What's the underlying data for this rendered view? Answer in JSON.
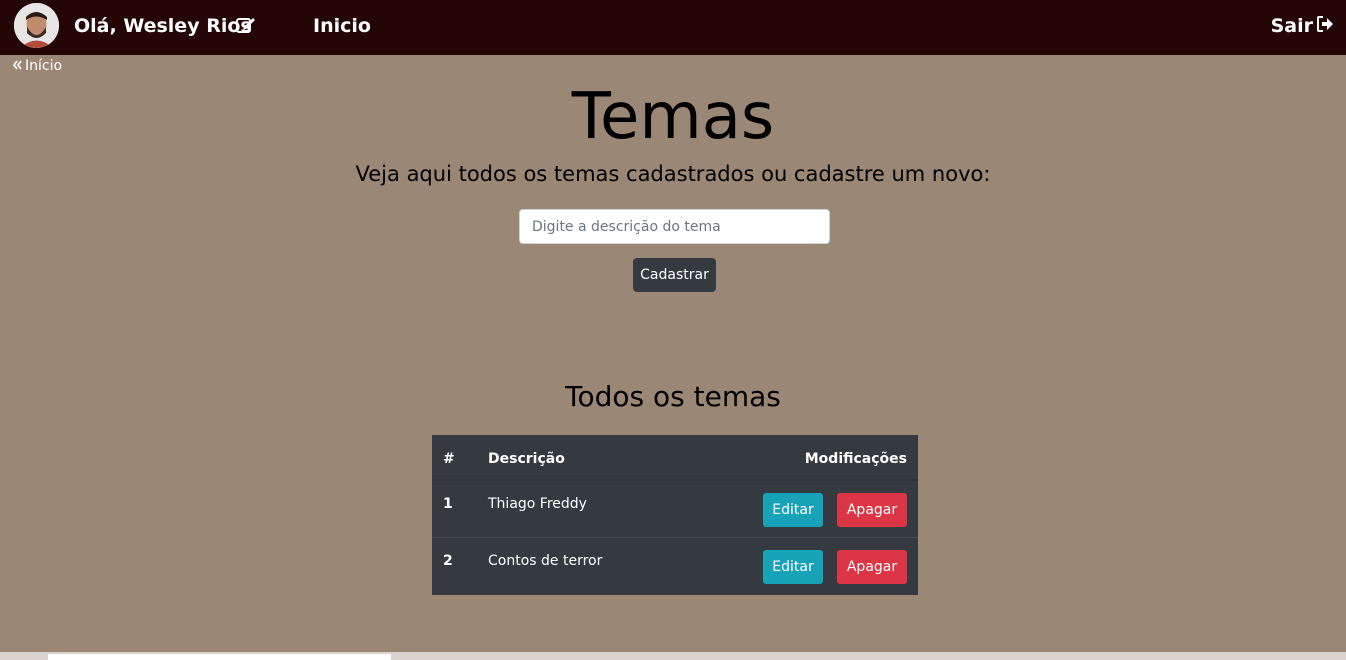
{
  "header": {
    "greeting": "Olá, Wesley Rios",
    "home_link": "Inicio",
    "logout": "Sair"
  },
  "breadcrumb": {
    "label": "Início"
  },
  "main": {
    "title": "Temas",
    "subtitle": "Veja aqui todos os temas cadastrados ou cadastre um novo:",
    "input_placeholder": "Digite a descrição do tema",
    "submit_label": "Cadastrar",
    "list_title": "Todos os temas"
  },
  "table": {
    "headers": {
      "id": "#",
      "description": "Descrição",
      "actions": "Modificações"
    },
    "rows": [
      {
        "id": "1",
        "description": "Thiago Freddy",
        "edit": "Editar",
        "delete": "Apagar"
      },
      {
        "id": "2",
        "description": "Contos de terror",
        "edit": "Editar",
        "delete": "Apagar"
      }
    ]
  },
  "colors": {
    "navbar": "#230605",
    "background": "#9a8775",
    "table": "#343a40",
    "edit": "#17a2b8",
    "delete": "#dc3545"
  },
  "icons": [
    "avatar",
    "edit-icon",
    "logout-icon",
    "chevron-double-left-icon"
  ]
}
